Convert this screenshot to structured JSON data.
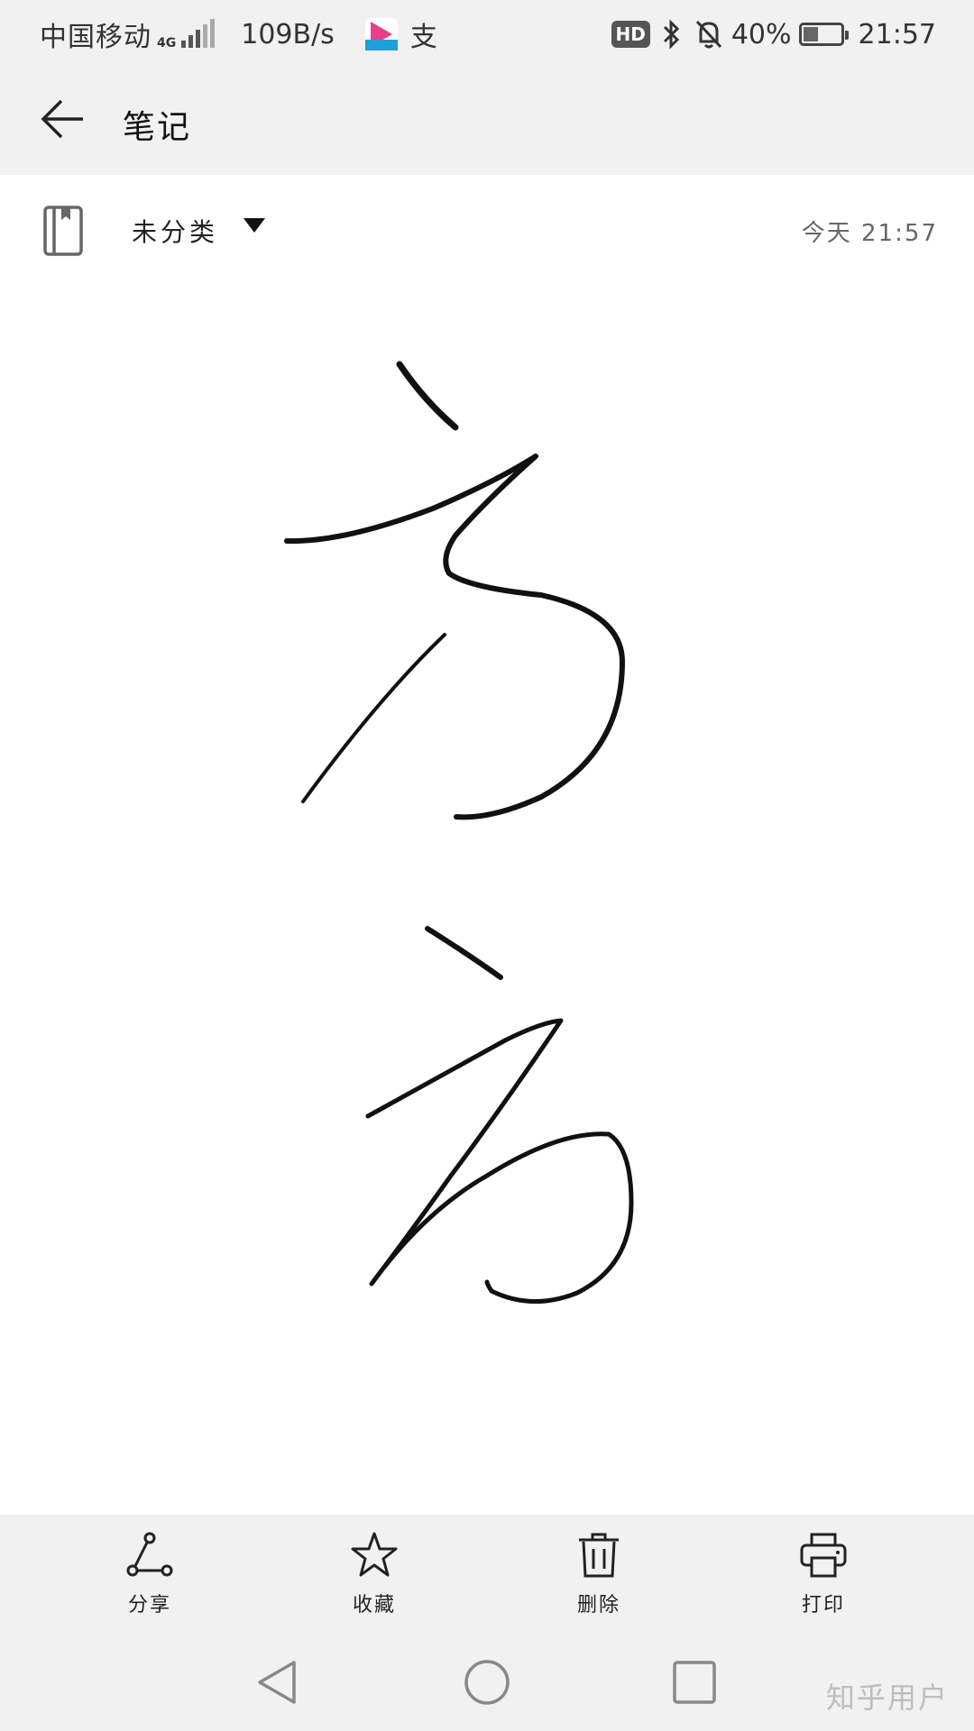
{
  "status_bar": {
    "carrier": "中国移动",
    "network": "4G",
    "speed": "109B/s",
    "app_badge_char": "支",
    "hd": "HD",
    "battery": "40%",
    "time": "21:57"
  },
  "app_bar": {
    "title": "笔记"
  },
  "note": {
    "category": "未分类",
    "timestamp": "今天  21:57"
  },
  "toolbar": {
    "items": [
      {
        "label": "分享",
        "icon": "share-icon"
      },
      {
        "label": "收藏",
        "icon": "star-icon"
      },
      {
        "label": "删除",
        "icon": "trash-icon"
      },
      {
        "label": "打印",
        "icon": "printer-icon"
      }
    ]
  },
  "watermark": "知乎用户"
}
